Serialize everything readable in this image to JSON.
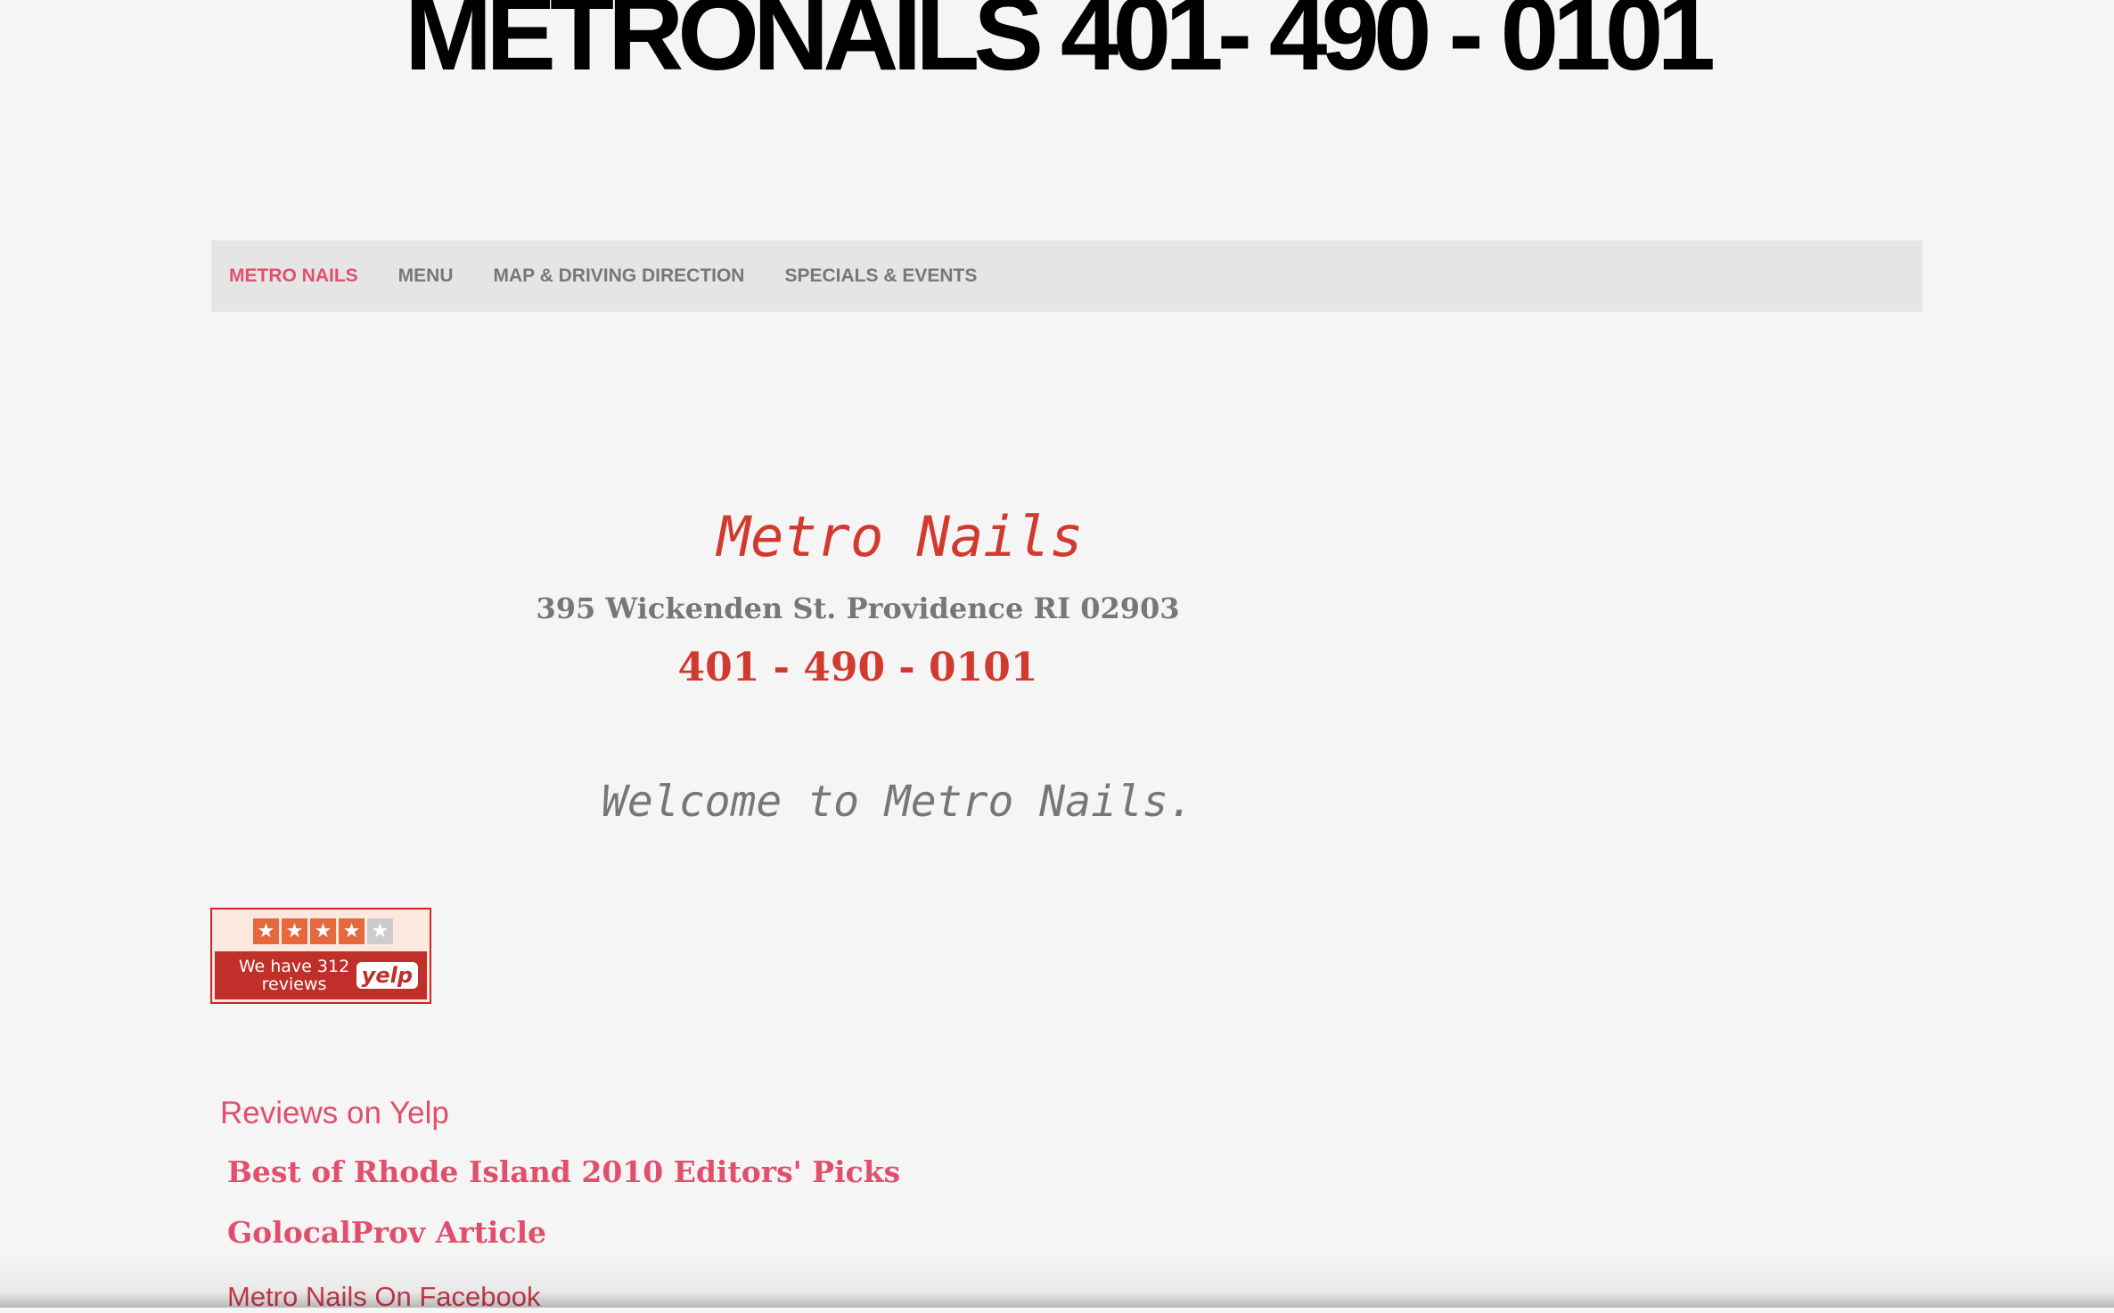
{
  "site": {
    "title": "METRONAILS 401- 490 - 0101"
  },
  "nav": {
    "items": [
      {
        "label": "METRO NAILS",
        "active": true
      },
      {
        "label": "MENU",
        "active": false
      },
      {
        "label": "MAP & DRIVING DIRECTION",
        "active": false
      },
      {
        "label": "SPECIALS & EVENTS",
        "active": false
      }
    ]
  },
  "business": {
    "name": "Metro Nails",
    "address": "395 Wickenden St. Providence RI 02903",
    "phone": "401 - 490 - 0101",
    "welcome": "Welcome to Metro Nails."
  },
  "yelp_badge": {
    "rating_stars": 4,
    "max_stars": 5,
    "text": "We have 312 reviews",
    "logo": "yelp",
    "colors": {
      "accent": "#c02f2a",
      "star": "#e5683f"
    }
  },
  "links": {
    "reviews": "Reviews on Yelp",
    "best_of": "Best of Rhode Island 2010 Editors' Picks",
    "golocal": "GolocalProv Article",
    "facebook": "Metro Nails On Facebook"
  },
  "colors": {
    "accent": "#e0506c",
    "brand_red": "#d13a2f",
    "muted_text": "#777777",
    "nav_bg": "#e5e5e5",
    "page_bg": "#f5f5f5"
  }
}
